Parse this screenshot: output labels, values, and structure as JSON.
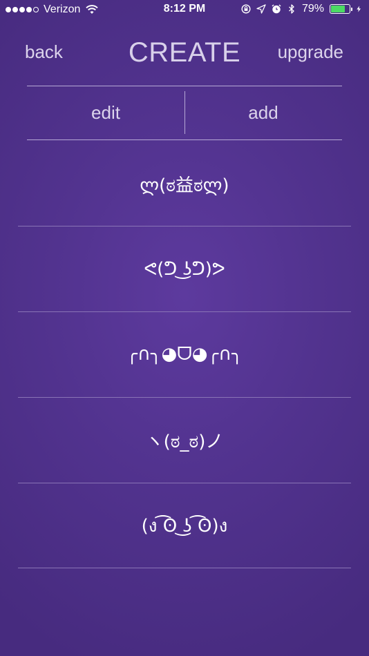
{
  "status_bar": {
    "carrier": "Verizon",
    "time": "8:12 PM",
    "battery_percent": "79%",
    "battery_level": 0.79,
    "signal_bars_filled": 4,
    "signal_bars_total": 5,
    "icons": [
      "wifi-icon",
      "lock-rotation-icon",
      "location-icon",
      "alarm-icon",
      "bluetooth-icon",
      "battery-icon",
      "charging-icon"
    ]
  },
  "nav": {
    "back_label": "back",
    "title": "CREATE",
    "upgrade_label": "upgrade"
  },
  "segments": {
    "edit_label": "edit",
    "add_label": "add"
  },
  "faces": [
    "ლ(ಠ益ಠლ)",
    "ᕙ(ᕤ ͜ʖᕤ)ᕗ",
    "╭∩╮◕ᗜ◕╭∩╮",
    "ヽ(ಠ_ಠ)ノ",
    "(ง ͡ʘ ͜ʖ ͡ʘ)ง"
  ],
  "colors": {
    "background": "#52338f",
    "text": "#ffffff",
    "muted_text": "#dcd4ec",
    "divider": "#b7a9d6",
    "battery_fill": "#4cd964"
  }
}
